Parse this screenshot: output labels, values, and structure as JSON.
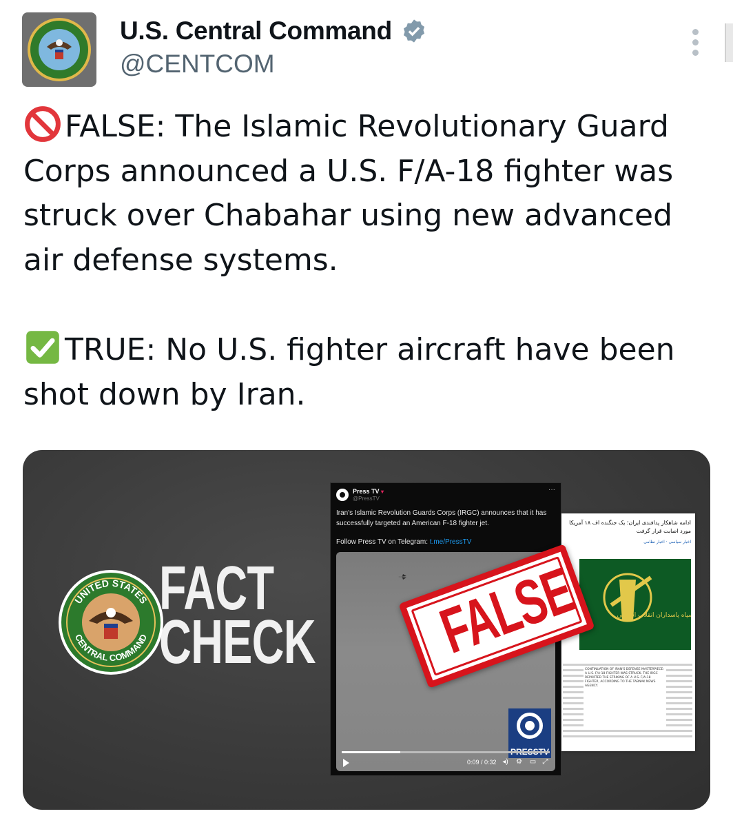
{
  "account": {
    "display_name": "U.S. Central Command",
    "handle": "@CENTCOM",
    "avatar": "centcom-seal",
    "verified_icon": "verified-badge-icon"
  },
  "tweet": {
    "false_emoji": "prohibited-icon",
    "false_text": "FALSE: The Islamic Revolutionary Guard Corps announced a U.S. F/A-18 fighter was struck over Chabahar using new advanced air defense systems.",
    "true_emoji": "check-mark-button-icon",
    "true_text": "TRUE: No U.S. fighter aircraft have been shot down by Iran."
  },
  "media": {
    "fact_check_line1": "FACT",
    "fact_check_line2": "CHECK",
    "seal_top": "UNITED STATES",
    "seal_bottom": "CENTRAL COMMAND",
    "stamp": "FALSE",
    "stamp_color": "#d7141c",
    "embedded_tweet": {
      "name": "Press TV",
      "handle": "@PressTV",
      "text": "Iran's Islamic Revolution Guards Corps (IRGC) announces that it has successfully targeted an American F-18 fighter jet.",
      "follow_label": "Follow Press TV on Telegram: ",
      "follow_link": "t.me/PressTV",
      "badge": "PRESSTV",
      "time": "0:09 / 0:32",
      "progress": 0.28
    },
    "article": {
      "title": "ادامه شاهکار پدافندی ایران؛ یک جنگنده اف ۱۸ آمریکا مورد اصابت قرار گرفت",
      "meta": "اخبار سیاسی · اخبار نظامی",
      "caption": "سپاه پاسداران انقلاب اسلامی",
      "quote": "CONTINUATION OF IRAN'S DEFENSE MASTERPIECE: A U.S. F/A-18 FIGHTER WAS STRUCK. THE IRGC REPORTED THE STRIKING OF A U.S. F/A-18 FIGHTER, ACCORDING TO THE TABNAK NEWS AGENCY."
    }
  }
}
